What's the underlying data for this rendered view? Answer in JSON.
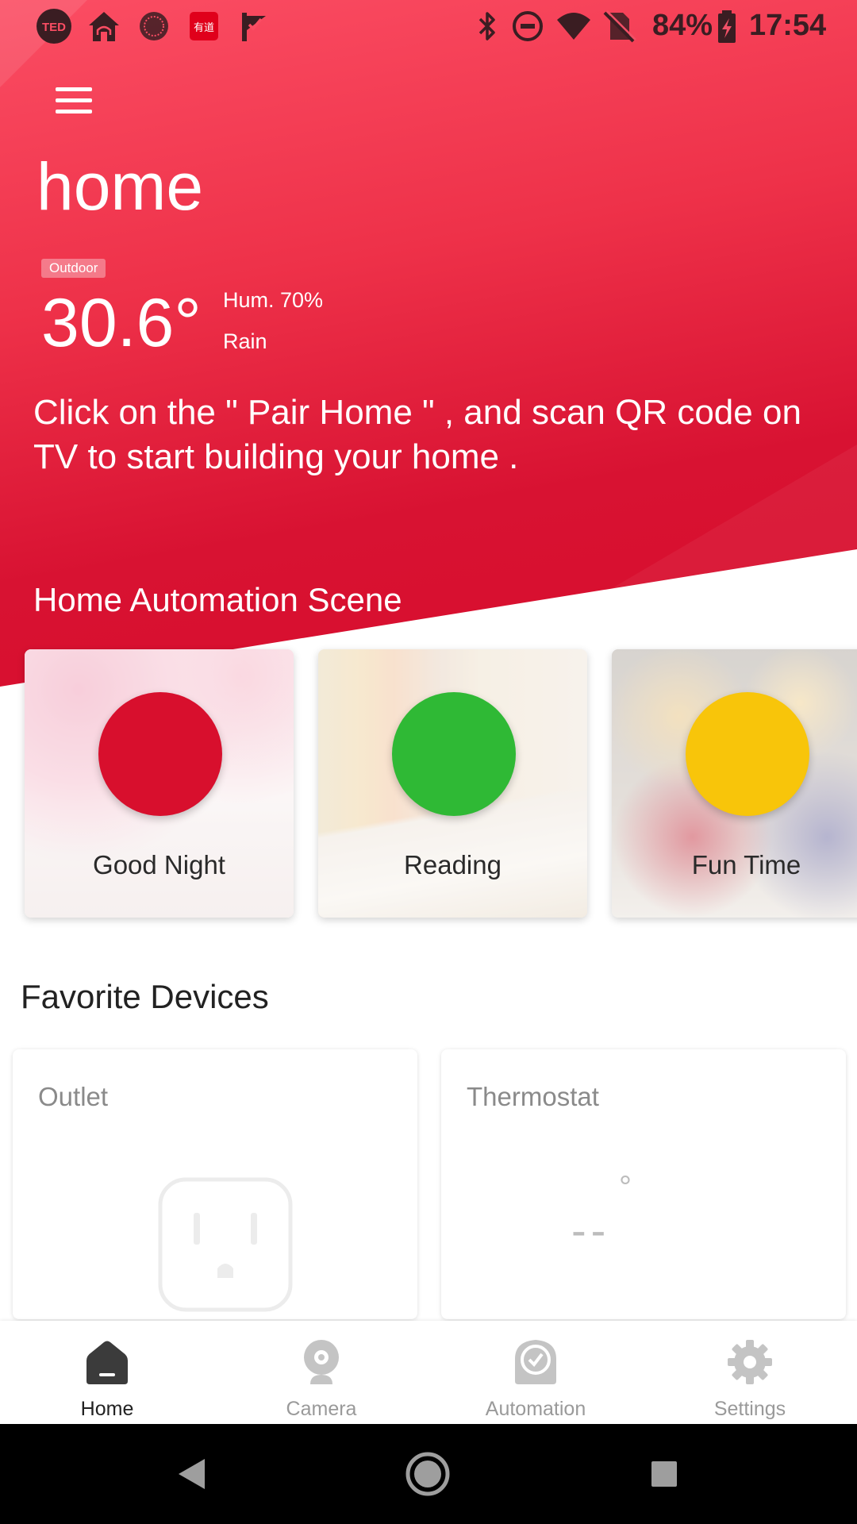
{
  "status_bar": {
    "left_icons": [
      "ted-icon",
      "home-app-icon",
      "circle-app-icon",
      "youdao-icon",
      "check-flag-icon"
    ],
    "ted_label": "TED",
    "youdao_label": "有道",
    "right_icons": [
      "bluetooth-icon",
      "do-not-disturb-icon",
      "wifi-icon",
      "no-sim-icon"
    ],
    "battery": "84%",
    "time": "17:54"
  },
  "header": {
    "title": "home"
  },
  "weather": {
    "badge": "Outdoor",
    "temperature": "30.6°",
    "humidity": "Hum. 70%",
    "condition": "Rain"
  },
  "hint": "Click on the \" Pair Home \" , and scan QR code on TV to start building your home .",
  "scenes": {
    "title": "Home Automation Scene",
    "items": [
      {
        "label": "Good Night",
        "color": "#d80f2d"
      },
      {
        "label": "Reading",
        "color": "#2fb935"
      },
      {
        "label": "Fun Time",
        "color": "#f8c50a"
      }
    ]
  },
  "favorites": {
    "title": "Favorite Devices",
    "devices": [
      {
        "label": "Outlet",
        "icon": "outlet-icon"
      },
      {
        "label": "Thermostat",
        "value": "--",
        "unit": "°"
      }
    ]
  },
  "bottom_nav": {
    "items": [
      {
        "label": "Home",
        "icon": "home-icon",
        "active": true
      },
      {
        "label": "Camera",
        "icon": "camera-icon",
        "active": false
      },
      {
        "label": "Automation",
        "icon": "automation-icon",
        "active": false
      },
      {
        "label": "Settings",
        "icon": "settings-icon",
        "active": false
      }
    ]
  },
  "system_nav": {
    "buttons": [
      "back-icon",
      "home-circle-icon",
      "recents-icon"
    ]
  },
  "colors": {
    "accent": "#e8213d",
    "active_nav": "#222222",
    "inactive_nav": "#9a9a9a"
  }
}
